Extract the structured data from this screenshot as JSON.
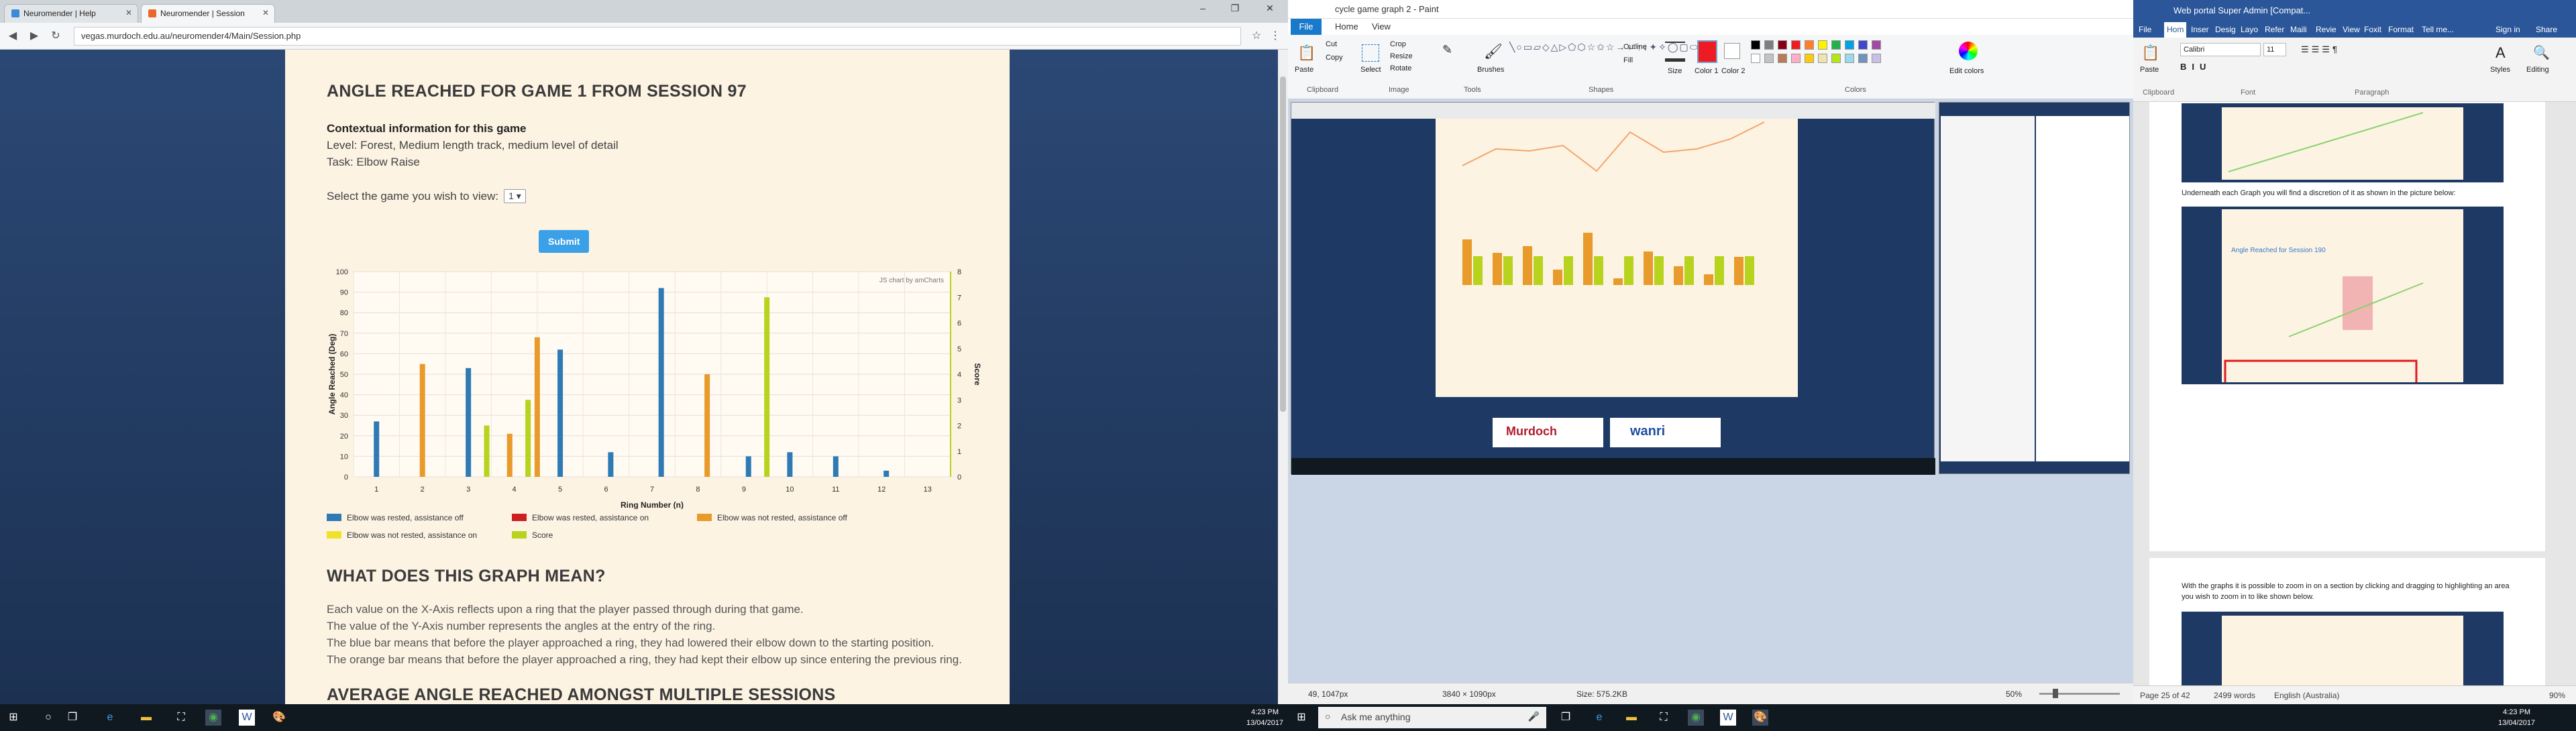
{
  "browser": {
    "tabs": [
      {
        "label": "Neuromender | Help",
        "fav_color": "#3c8bd8"
      },
      {
        "label": "Neuromender | Session",
        "fav_color": "#e86a2a"
      }
    ],
    "address": "vegas.murdoch.edu.au/neuromender4/Main/Session.php",
    "window_controls": [
      "–",
      "❐",
      "✕"
    ],
    "nav_icons": [
      "◀",
      "▶",
      "↻"
    ]
  },
  "session": {
    "title": "ANGLE REACHED FOR GAME 1 FROM SESSION 97",
    "context_heading": "Contextual information for this game",
    "level": "Level: Forest, Medium length track, medium level of detail",
    "task": "Task: Elbow Raise",
    "select_label": "Select the game you wish to view:",
    "select_value": "1",
    "submit_label": "Submit"
  },
  "chart_data": {
    "type": "bar",
    "title": "",
    "credit": "JS chart by amCharts",
    "xlabel": "Ring Number (n)",
    "ylabel": "Angle Reached (Deg)",
    "y2label": "Score",
    "ylim": [
      0,
      100
    ],
    "y2lim": [
      0,
      8
    ],
    "yticks": [
      "0",
      "10",
      "20",
      "30",
      "40",
      "50",
      "60",
      "70",
      "80",
      "90",
      "100"
    ],
    "y2ticks": [
      "0",
      "1",
      "2",
      "3",
      "4",
      "5",
      "6",
      "7",
      "8"
    ],
    "x": [
      "1",
      "2",
      "3",
      "4",
      "5",
      "6",
      "7",
      "8",
      "9",
      "10",
      "11",
      "12",
      "13"
    ],
    "grid": true,
    "legend_position": "bottom",
    "series": [
      {
        "name": "Elbow was rested, assistance off",
        "color": "#2f7ab5",
        "points": [
          [
            0.5,
            27
          ],
          [
            2.5,
            53
          ],
          [
            4.5,
            62
          ],
          [
            5.6,
            12
          ],
          [
            6.7,
            92
          ],
          [
            8.6,
            10
          ],
          [
            9.5,
            12
          ],
          [
            10.5,
            10
          ],
          [
            11.6,
            3
          ]
        ]
      },
      {
        "name": "Elbow was rested, assistance on",
        "color": "#cc1f1f",
        "points": []
      },
      {
        "name": "Elbow was not rested, assistance off",
        "color": "#e89a2a",
        "points": [
          [
            1.5,
            55
          ],
          [
            3.4,
            21
          ],
          [
            4.0,
            68
          ],
          [
            7.7,
            50
          ]
        ]
      },
      {
        "name": "Elbow was not rested, assistance on",
        "color": "#f0e22a",
        "points": []
      },
      {
        "name": "Score",
        "color": "#b7d31e",
        "points": [
          [
            2.9,
            2
          ],
          [
            3.8,
            3
          ],
          [
            9.0,
            7
          ]
        ]
      }
    ]
  },
  "legend": [
    "Elbow was rested, assistance off",
    "Elbow was rested, assistance on",
    "Elbow was not rested, assistance off",
    "Elbow was not rested, assistance on",
    "Score"
  ],
  "meaning": {
    "heading": "WHAT DOES THIS GRAPH MEAN?",
    "lines": [
      "Each value on the X-Axis reflects upon a ring that the player passed through during that game.",
      "The value of the Y-Axis number represents the angles at the entry of the ring.",
      "The blue bar means that before the player approached a ring, they had lowered their elbow down to the starting position.",
      "The orange bar means that before the player approached a ring, they had kept their elbow up since entering the previous ring."
    ]
  },
  "average": {
    "heading": "AVERAGE ANGLE REACHED AMONGST MULTIPLE SESSIONS"
  },
  "paint": {
    "title": "cycle game graph 2 - Paint",
    "menu": [
      "File",
      "Home",
      "View"
    ],
    "groups": [
      "Clipboard",
      "Image",
      "Tools",
      "Shapes",
      "Colors"
    ],
    "tools": [
      "Paste",
      "Cut",
      "Copy",
      "Crop",
      "Resize",
      "Rotate",
      "Select",
      "Brushes",
      "Outline",
      "Fill",
      "Size",
      "Color 1",
      "Color 2",
      "Edit colors"
    ],
    "palette": [
      "#000000",
      "#7f7f7f",
      "#880015",
      "#ed1c24",
      "#ff7f27",
      "#fff200",
      "#22b14c",
      "#00a2e8",
      "#3f48cc",
      "#a349a4",
      "#ffffff",
      "#c3c3c3",
      "#b97a57",
      "#ffaec9",
      "#ffc90e",
      "#efe4b0",
      "#b5e61d",
      "#99d9ea",
      "#7092be",
      "#c8bfe7"
    ],
    "status": {
      "pos": "49, 1047px",
      "dims": "3840 × 1090px",
      "size": "Size: 575.2KB",
      "zoom": "50%"
    },
    "logos": [
      "Murdoch",
      "wanri"
    ]
  },
  "word": {
    "title": "Web portal Super Admin [Compat...",
    "menu": [
      "File",
      "Hom",
      "Inser",
      "Desig",
      "Layo",
      "Refer",
      "Maili",
      "Revie",
      "View",
      "Foxit",
      "Format",
      "Tell me..."
    ],
    "sign_in": "Sign in",
    "share": "Share",
    "ribbon": [
      "Paste",
      "Calibri",
      "11",
      "Styles",
      "Editing",
      "Clipboard",
      "Font",
      "Paragraph"
    ],
    "text1": "Underneath each Graph you will find a discretion of it as shown in the picture below:",
    "text2": "With the graphs it is possible to zoom in on a section by clicking and dragging to highlighting an area you wish to zoom in to like shown below.",
    "sub_heading": "Angle Reached for Session 190",
    "status": {
      "page": "Page 25 of 42",
      "words": "2499 words",
      "lang": "English (Australia)",
      "zoom": "90%"
    }
  },
  "taskbar": {
    "search_placeholder": "Ask me anything",
    "time": "4:23 PM",
    "date": "13/04/2017"
  }
}
